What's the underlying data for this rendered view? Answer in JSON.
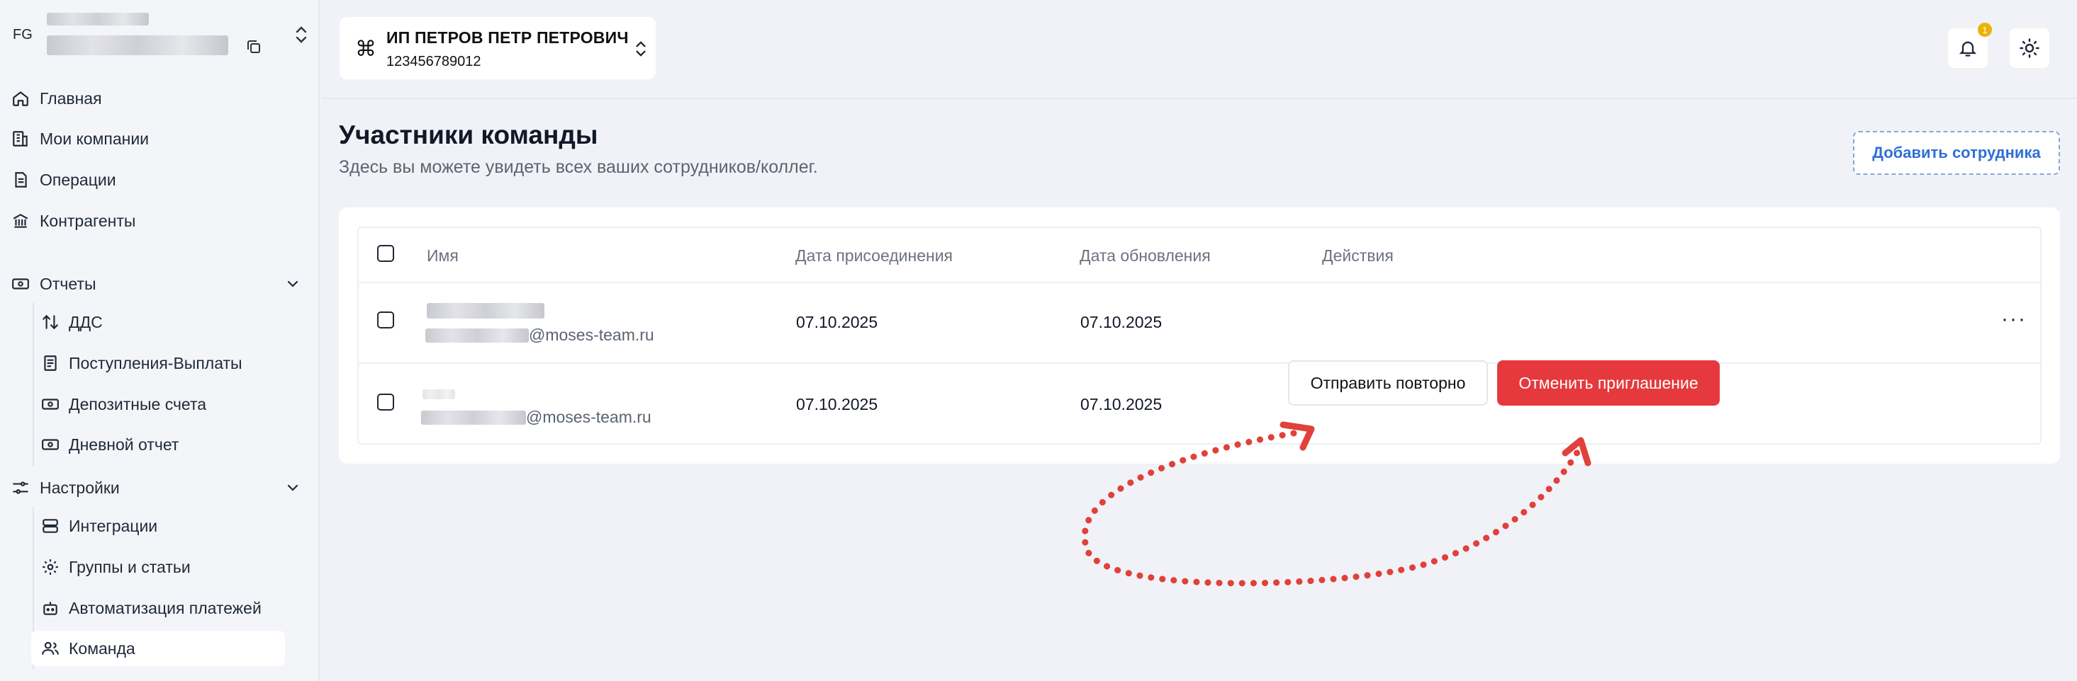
{
  "account": {
    "initials": "FG"
  },
  "sidebar": {
    "items": [
      {
        "label": "Главная",
        "icon": "home-icon"
      },
      {
        "label": "Мои компании",
        "icon": "buildings-icon"
      },
      {
        "label": "Операции",
        "icon": "document-icon"
      },
      {
        "label": "Контрагенты",
        "icon": "bank-icon"
      }
    ],
    "reports": {
      "label": "Отчеты",
      "icon": "banknote-icon",
      "items": [
        {
          "label": "ДДС",
          "icon": "arrows-updown-icon"
        },
        {
          "label": "Поступления-Выплаты",
          "icon": "receipt-icon"
        },
        {
          "label": "Депозитные счета",
          "icon": "banknote-icon"
        },
        {
          "label": "Дневной отчет",
          "icon": "banknote-icon"
        }
      ]
    },
    "settings": {
      "label": "Настройки",
      "icon": "sliders-icon",
      "items": [
        {
          "label": "Интеграции",
          "icon": "server-icon"
        },
        {
          "label": "Группы и статьи",
          "icon": "gear-icon"
        },
        {
          "label": "Автоматизация платежей",
          "icon": "robot-icon"
        },
        {
          "label": "Команда",
          "icon": "users-icon",
          "active": true
        }
      ]
    }
  },
  "company": {
    "name": "ИП ПЕТРОВ ПЕТР ПЕТРОВИЧ",
    "inn": "123456789012"
  },
  "notifications": {
    "count": "1"
  },
  "page": {
    "title": "Участники команды",
    "subtitle": "Здесь вы можете увидеть всех ваших сотрудников/коллег.",
    "add_button": "Добавить сотрудника"
  },
  "table": {
    "columns": [
      "Имя",
      "Дата присоединения",
      "Дата обновления",
      "Действия"
    ],
    "rows": [
      {
        "email_domain": "@moses-team.ru",
        "joined": "07.10.2025",
        "updated": "07.10.2025",
        "more": "···"
      },
      {
        "email_domain": "@moses-team.ru",
        "joined": "07.10.2025",
        "updated": "07.10.2025",
        "resend": "Отправить повторно",
        "cancel": "Отменить приглашение"
      }
    ]
  },
  "colors": {
    "accent": "#2f6fd6",
    "danger": "#e5393d",
    "badge": "#eab308",
    "annotation": "#e0413a"
  }
}
